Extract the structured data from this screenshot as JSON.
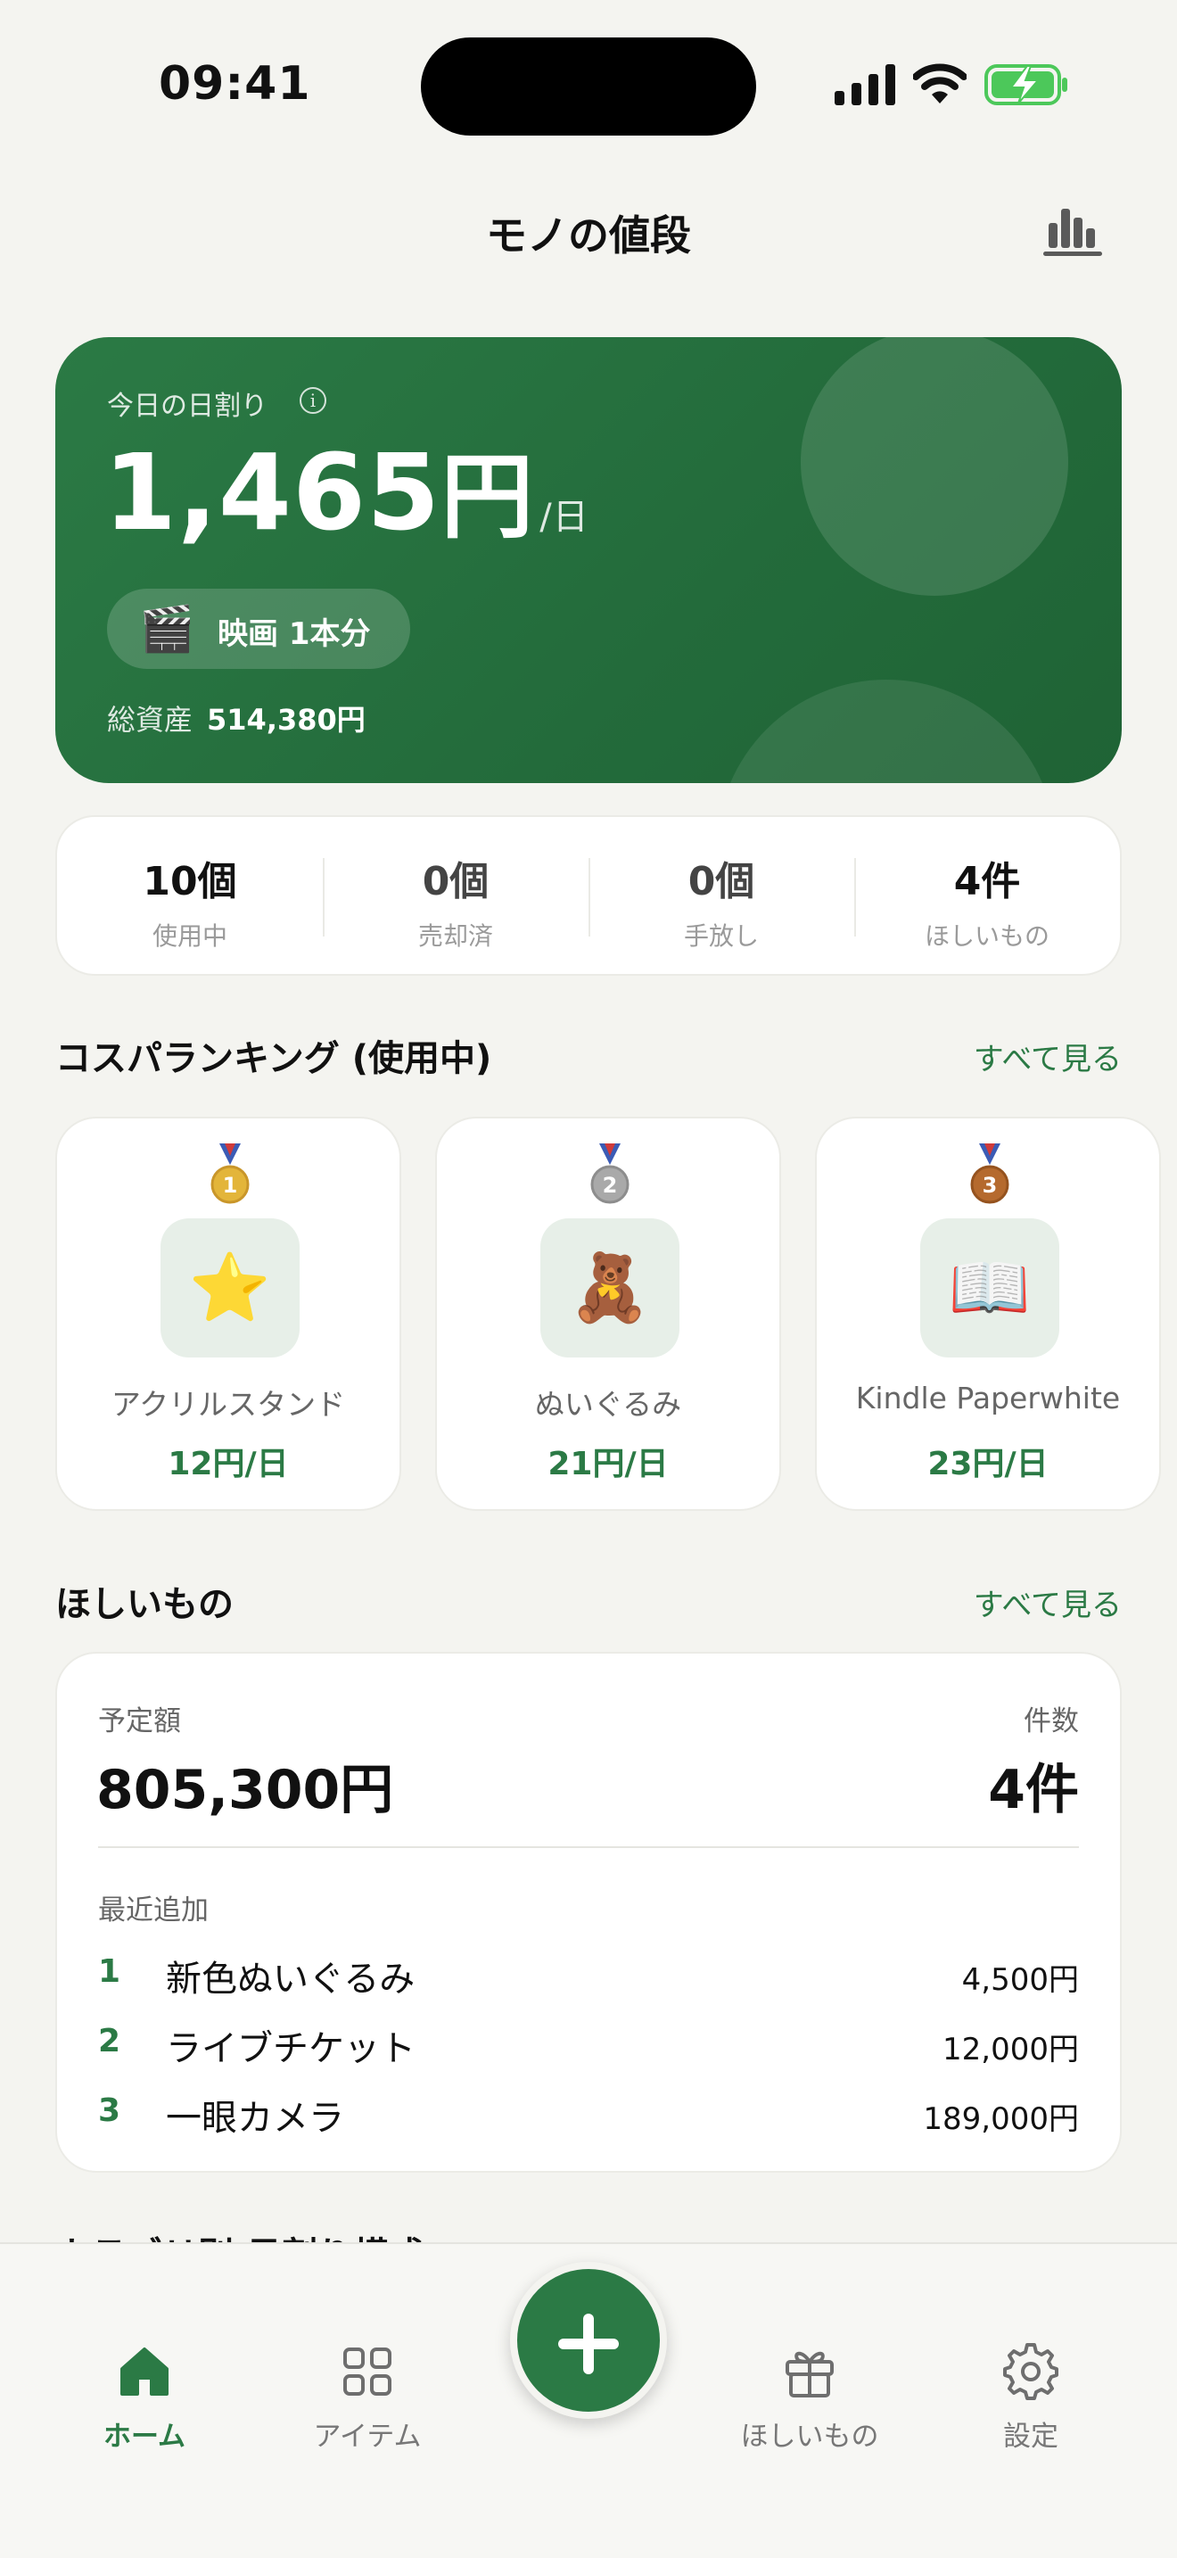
{
  "status_bar": {
    "time": "09:41"
  },
  "header": {
    "title": "モノの値段"
  },
  "hero": {
    "label": "今日の日割り",
    "amount": "1,465",
    "amount_unit": "円",
    "per": "/日",
    "equivalent_icon": "🎬",
    "equivalent_text": "映画 1本分",
    "total_label": "総資産",
    "total_value": "514,380円"
  },
  "counts": [
    {
      "value": "10個",
      "label": "使用中"
    },
    {
      "value": "0個",
      "label": "売却済"
    },
    {
      "value": "0個",
      "label": "手放し"
    },
    {
      "value": "4件",
      "label": "ほしいもの"
    }
  ],
  "ranking": {
    "title": "コスパランキング (使用中)",
    "see_all": "すべて見る",
    "items": [
      {
        "rank": "1",
        "medal_color": "#e3b53a",
        "icon": "⭐",
        "name": "アクリルスタンド",
        "price": "12円/日"
      },
      {
        "rank": "2",
        "medal_color": "#a9a9a9",
        "icon": "🧸",
        "name": "ぬいぐるみ",
        "price": "21円/日"
      },
      {
        "rank": "3",
        "medal_color": "#b56a2e",
        "icon": "📖",
        "name": "Kindle Paperwhite",
        "price": "23円/日"
      }
    ]
  },
  "wishlist": {
    "title": "ほしいもの",
    "see_all": "すべて見る",
    "budget_label": "予定額",
    "budget_value": "805,300円",
    "count_label": "件数",
    "count_value": "4件",
    "recent_label": "最近追加",
    "items": [
      {
        "rank": "1",
        "name": "新色ぬいぐるみ",
        "price": "4,500円"
      },
      {
        "rank": "2",
        "name": "ライブチケット",
        "price": "12,000円"
      },
      {
        "rank": "3",
        "name": "一眼カメラ",
        "price": "189,000円"
      }
    ]
  },
  "next_section": {
    "title": "カテゴリ別 日割り構成"
  },
  "tab_bar": {
    "accent": "#2b7a45",
    "tabs": [
      {
        "label": "ホーム",
        "icon": "home-icon",
        "active": true
      },
      {
        "label": "アイテム",
        "icon": "grid-icon",
        "active": false
      },
      {
        "label": "ほしいもの",
        "icon": "gift-icon",
        "active": false
      },
      {
        "label": "設定",
        "icon": "gear-icon",
        "active": false
      }
    ]
  }
}
